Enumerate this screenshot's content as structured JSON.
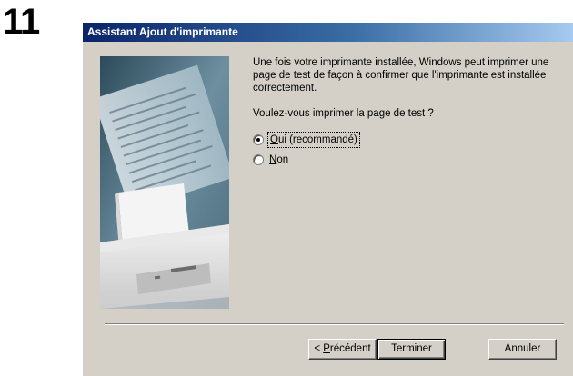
{
  "step": {
    "number": "11"
  },
  "window": {
    "title": "Assistant Ajout d'imprimante"
  },
  "content": {
    "description": "Une fois votre imprimante installée, Windows peut imprimer une page de test de façon à confirmer que l'imprimante est installée correctement.",
    "question": "Voulez-vous imprimer la page de test ?",
    "options": [
      {
        "accel": "O",
        "rest": "ui (recommandé)",
        "checked": true
      },
      {
        "accel": "N",
        "rest": "on",
        "checked": false
      }
    ]
  },
  "buttons": {
    "back": {
      "prefix": "< ",
      "accel": "P",
      "rest": "récédent"
    },
    "finish": "Terminer",
    "cancel": "Annuler"
  },
  "colors": {
    "dialog_bg": "#d4d0c8",
    "titlebar_start": "#0a246a",
    "titlebar_end": "#a6caf0"
  },
  "icons": {
    "illustration": "printer-illustration"
  }
}
